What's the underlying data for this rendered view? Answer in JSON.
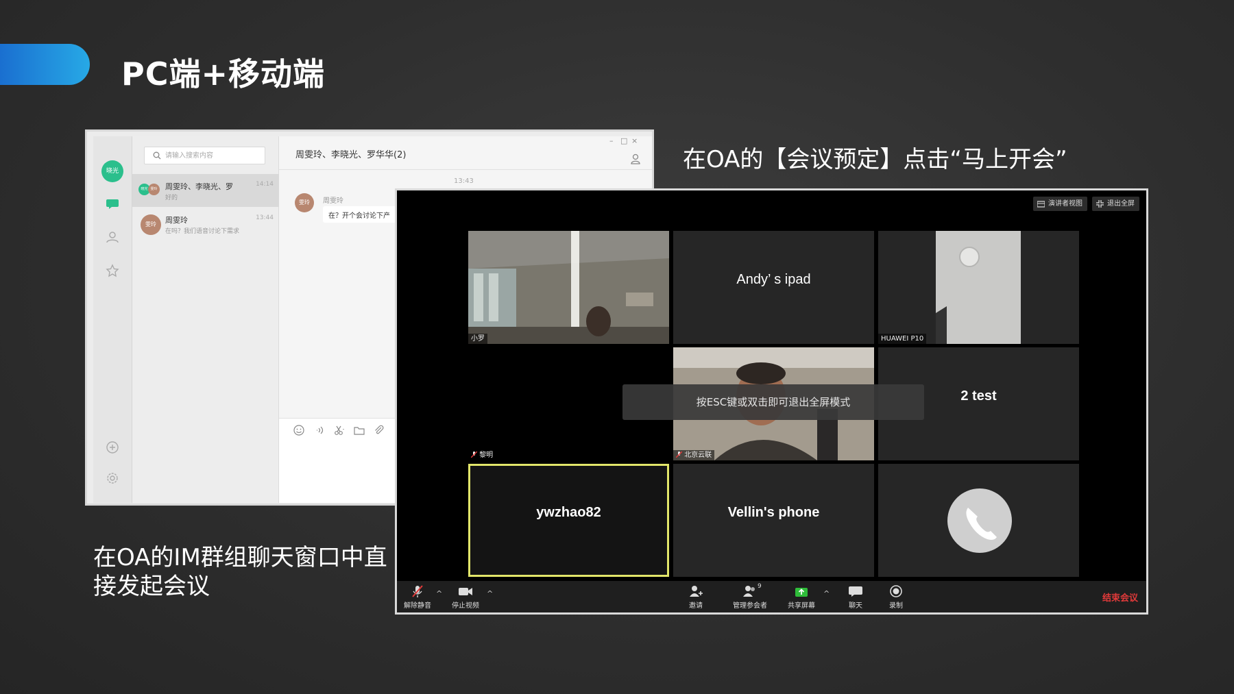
{
  "slide": {
    "title": "PC端+移动端",
    "caption_right": "在OA的【会议预定】点击“马上开会”",
    "caption_left": "在OA的IM群组聊天窗口中直接发起会议",
    "accent_color": "#1f8fe0"
  },
  "im": {
    "rail_avatar": "晓光",
    "search_placeholder": "请输入搜索内容",
    "conversations": [
      {
        "name": "周雯玲、李晓光、罗",
        "snippet": "好的",
        "time": "14:14",
        "avatars": [
          "晓光",
          "雯玲"
        ]
      },
      {
        "name": "周雯玲",
        "snippet": "在吗？我们语音讨论下需求",
        "time": "13:44",
        "avatar": "雯玲"
      }
    ],
    "chat": {
      "title": "周雯玲、李晓光、罗华华(2)",
      "time": "13:43",
      "sender": "周雯玲",
      "sender_avatar": "雯玲",
      "message": "在？开个会讨论下产",
      "window_controls": [
        "–",
        "□",
        "×"
      ]
    }
  },
  "meeting": {
    "top_buttons": [
      "演讲者视图",
      "退出全屏"
    ],
    "tiles": [
      {
        "label": "",
        "nametag": "小罗",
        "type": "video-office"
      },
      {
        "label": "Andy’ s ipad",
        "nametag": "",
        "type": "name"
      },
      {
        "label": "",
        "nametag": "HUAWEI P10",
        "type": "video-wall"
      },
      {
        "label": "",
        "nametag": "黎明",
        "type": "empty"
      },
      {
        "label": "",
        "nametag": "北京云联",
        "type": "video-person"
      },
      {
        "label": "2 test",
        "nametag": "",
        "type": "name"
      },
      {
        "label": "ywzhao82",
        "nametag": "",
        "type": "name-active"
      },
      {
        "label": "Vellin's phone",
        "nametag": "",
        "type": "name"
      },
      {
        "label": "",
        "nametag": "",
        "type": "phone"
      }
    ],
    "esc_toast": "按ESC键或双击即可退出全屏模式",
    "toolbar": {
      "unmute": "解除静音",
      "stop_video": "停止视频",
      "invite": "邀请",
      "manage": "管理参会者",
      "participant_count": "9",
      "share": "共享屏幕",
      "chat": "聊天",
      "record": "录制",
      "end": "结束会议"
    }
  }
}
